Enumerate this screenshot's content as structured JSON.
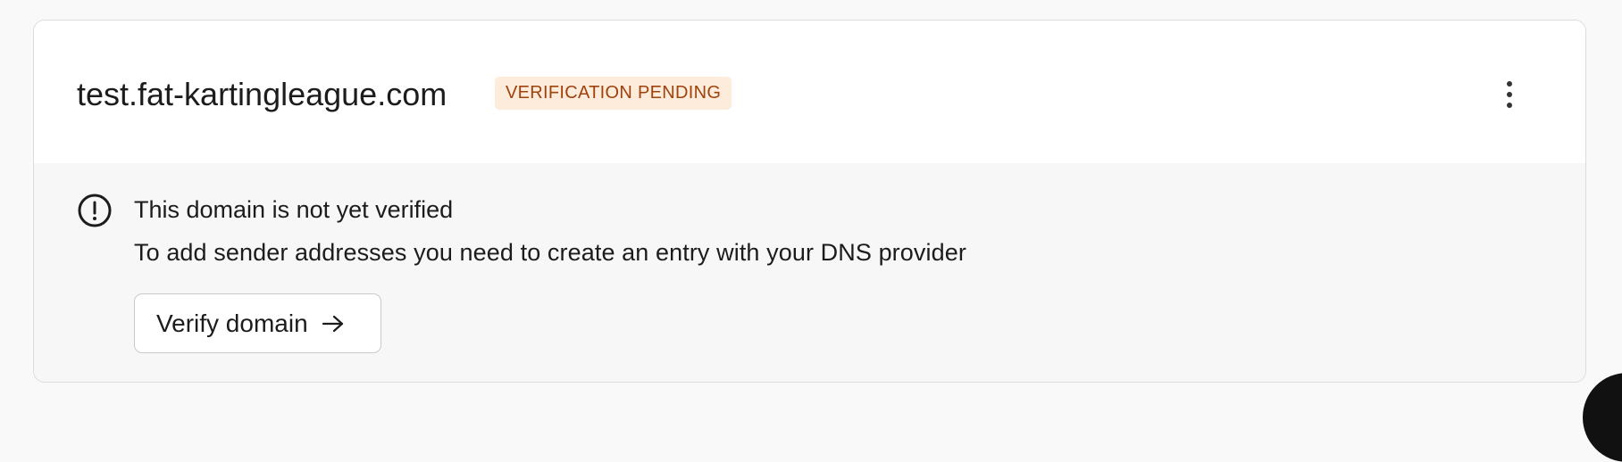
{
  "domain": {
    "name": "test.fat-kartingleague.com",
    "status": "VERIFICATION PENDING",
    "status_color": "#a0420c",
    "status_bg": "#fdecdc",
    "more_icon": "more-vertical-icon"
  },
  "alert": {
    "icon": "alert-circle-icon",
    "title": "This domain is not yet verified",
    "description": "To add sender addresses you need to create an entry with your DNS provider"
  },
  "actions": {
    "verify_label": "Verify domain",
    "verify_icon": "arrow-right-icon"
  }
}
